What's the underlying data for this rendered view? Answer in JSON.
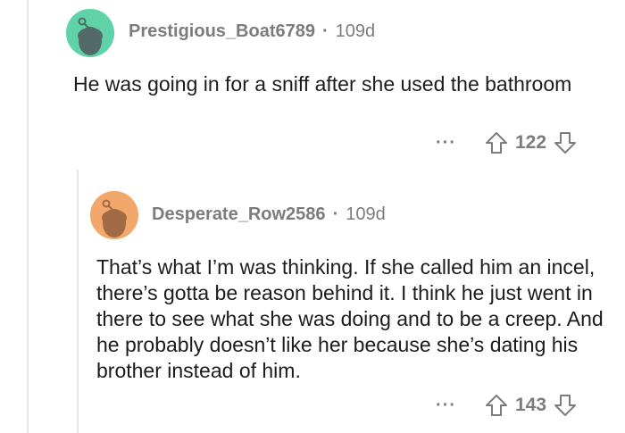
{
  "comments": [
    {
      "username": "Prestigious_Boat6789",
      "separator": "·",
      "age": "109d",
      "text": "He was going in for a sniff after she used the bathroom",
      "more": "···",
      "score": "122",
      "avatar_color": "#5fd2a8"
    },
    {
      "username": "Desperate_Row2586",
      "separator": "·",
      "age": "109d",
      "text": "That’s what I’m was thinking. If she called him an incel, there’s gotta be reason behind it. I think he just went in there to see what she was doing and to be a creep. And he probably doesn’t like her because she’s dating his brother instead of him.",
      "more": "···",
      "score": "143",
      "avatar_color": "#f2a86b"
    }
  ]
}
